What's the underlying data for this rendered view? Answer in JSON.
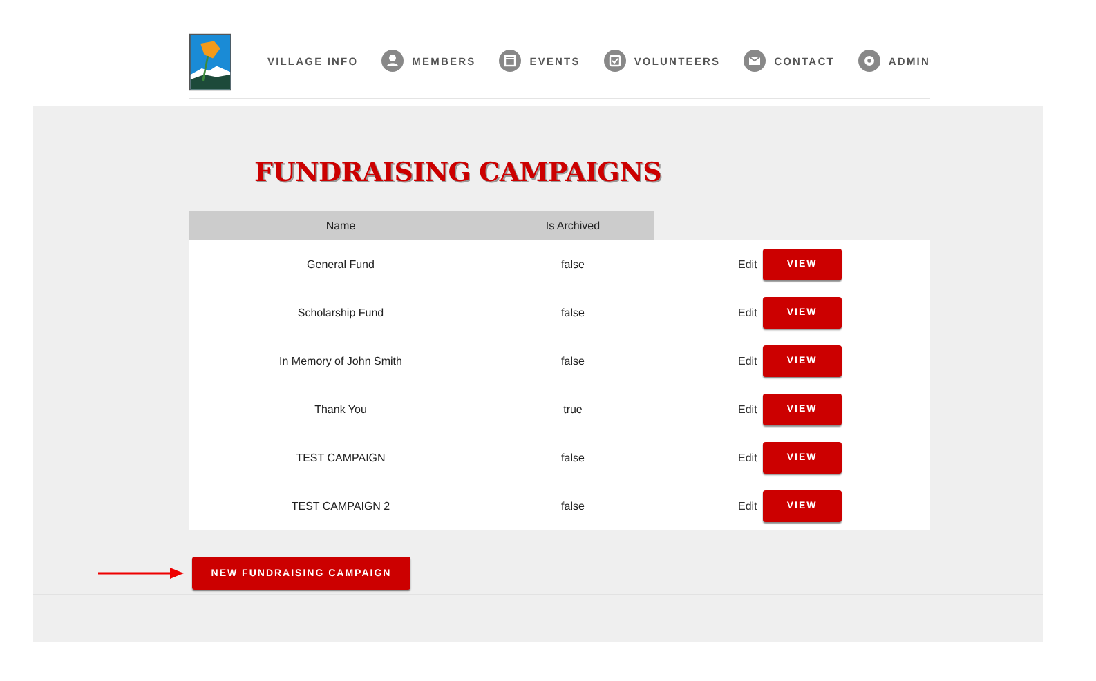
{
  "nav": [
    {
      "label": "VILLAGE INFO",
      "kind": "plain"
    },
    {
      "label": "MEMBERS",
      "kind": "person"
    },
    {
      "label": "EVENTS",
      "kind": "calendar"
    },
    {
      "label": "VOLUNTEERS",
      "kind": "check"
    },
    {
      "label": "CONTACT",
      "kind": "mail"
    },
    {
      "label": "ADMIN",
      "kind": "gear"
    }
  ],
  "title": "FUNDRAISING CAMPAIGNS",
  "table": {
    "columns": [
      "Name",
      "Is Archived"
    ],
    "rows": [
      {
        "name": "General Fund",
        "archived": "false",
        "edit": "Edit",
        "view": "VIEW"
      },
      {
        "name": "Scholarship Fund",
        "archived": "false",
        "edit": "Edit",
        "view": "VIEW"
      },
      {
        "name": "In Memory of John Smith",
        "archived": "false",
        "edit": "Edit",
        "view": "VIEW"
      },
      {
        "name": "Thank You",
        "archived": "true",
        "edit": "Edit",
        "view": "VIEW"
      },
      {
        "name": "TEST CAMPAIGN",
        "archived": "false",
        "edit": "Edit",
        "view": "VIEW"
      },
      {
        "name": "TEST CAMPAIGN 2",
        "archived": "false",
        "edit": "Edit",
        "view": "VIEW"
      }
    ]
  },
  "new_button": "NEW FUNDRAISING CAMPAIGN"
}
